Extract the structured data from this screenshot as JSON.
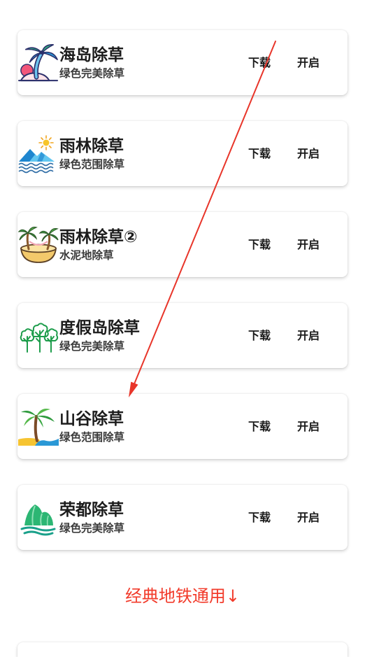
{
  "cards": [
    {
      "title": "海岛除草",
      "subtitle": "绿色完美除草",
      "download_label": "下载",
      "open_label": "开启",
      "icon": "palm-island-icon"
    },
    {
      "title": "雨林除草",
      "subtitle": "绿色范围除草",
      "download_label": "下载",
      "open_label": "开启",
      "icon": "mountain-sun-waves-icon"
    },
    {
      "title": "雨林除草②",
      "subtitle": "水泥地除草",
      "download_label": "下载",
      "open_label": "开启",
      "icon": "palm-bowl-island-icon"
    },
    {
      "title": "度假岛除草",
      "subtitle": "绿色完美除草",
      "download_label": "下载",
      "open_label": "开启",
      "icon": "forest-trees-icon"
    },
    {
      "title": "山谷除草",
      "subtitle": "绿色范围除草",
      "download_label": "下载",
      "open_label": "开启",
      "icon": "palm-beach-icon"
    },
    {
      "title": "荣都除草",
      "subtitle": "绿色完美除草",
      "download_label": "下载",
      "open_label": "开启",
      "icon": "green-hills-waves-icon"
    }
  ],
  "section_heading": "经典地铁通用↓",
  "colors": {
    "section_heading": "#f23b2b",
    "annotation_arrow": "#e8352a",
    "card_background": "#ffffff",
    "page_background": "#ffffff"
  }
}
